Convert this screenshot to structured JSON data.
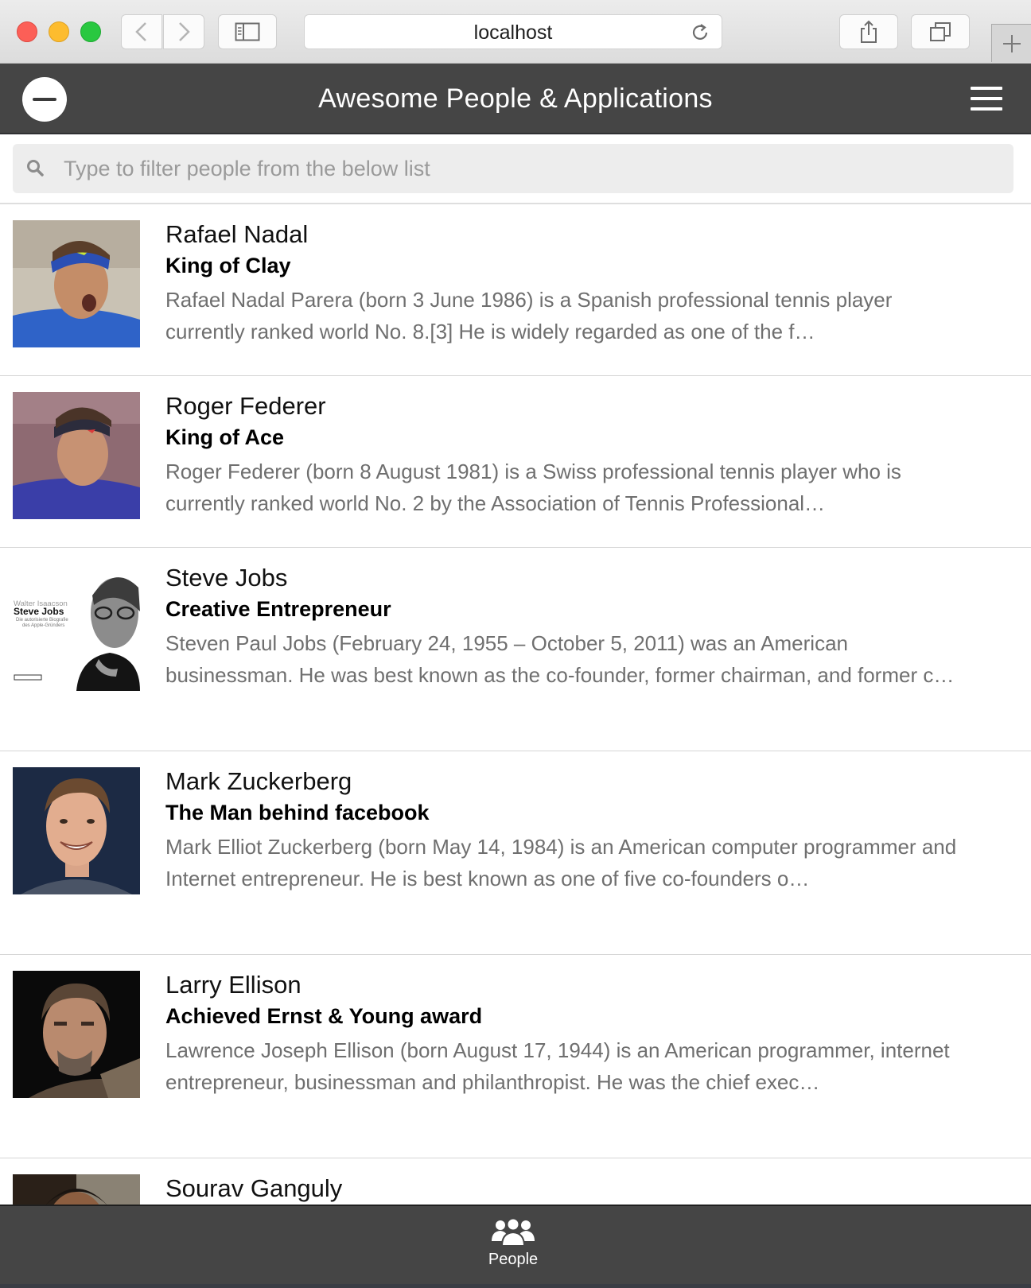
{
  "browser": {
    "url": "localhost",
    "icons": {
      "back": "chevron-left-icon",
      "forward": "chevron-right-icon",
      "sidebar": "sidebar-icon",
      "reload": "reload-icon",
      "share": "share-icon",
      "tabs": "tabs-icon",
      "new_tab": "plus-icon"
    }
  },
  "header": {
    "title": "Awesome People & Applications"
  },
  "search": {
    "placeholder": "Type to filter people from the below list",
    "value": ""
  },
  "people": [
    {
      "name": "Rafael Nadal",
      "title": "King of Clay",
      "description": "Rafael Nadal Parera (born 3 June 1986) is a Spanish professional tennis player currently ranked world No. 8.[3] He is widely regarded as one of the f…"
    },
    {
      "name": "Roger Federer",
      "title": "King of Ace",
      "description": "Roger Federer (born 8 August 1981) is a Swiss professional tennis player who is currently ranked world No. 2 by the Association of Tennis Professional…"
    },
    {
      "name": "Steve Jobs",
      "title": "Creative Entrepreneur",
      "description": "Steven Paul Jobs (February 24, 1955 – October 5, 2011) was an American businessman. He was best known as the co-founder, former chairman, and former c…",
      "book_cover": {
        "author": "Walter Isaacson",
        "book_title": "Steve Jobs",
        "subtitle_line1": "Die autorisierte Biografie",
        "subtitle_line2": "des Apple-Gründers"
      }
    },
    {
      "name": "Mark Zuckerberg",
      "title": "The Man behind facebook",
      "description": "Mark Elliot Zuckerberg (born May 14, 1984) is an American computer programmer and Internet entrepreneur. He is best known as one of five co-founders o…"
    },
    {
      "name": "Larry Ellison",
      "title": "Achieved Ernst & Young award",
      "description": "Lawrence Joseph Ellison (born August 17, 1944) is an American programmer, internet entrepreneur, businessman and philanthropist. He was the chief exec…"
    },
    {
      "name": "Sourav Ganguly",
      "title": "",
      "description": ""
    }
  ],
  "tabbar": {
    "tabs": [
      {
        "label": "People",
        "icon": "people-icon"
      }
    ]
  },
  "colors": {
    "header_bg": "#454545",
    "description_text": "#6f6f6f",
    "search_bg": "#ededed"
  }
}
